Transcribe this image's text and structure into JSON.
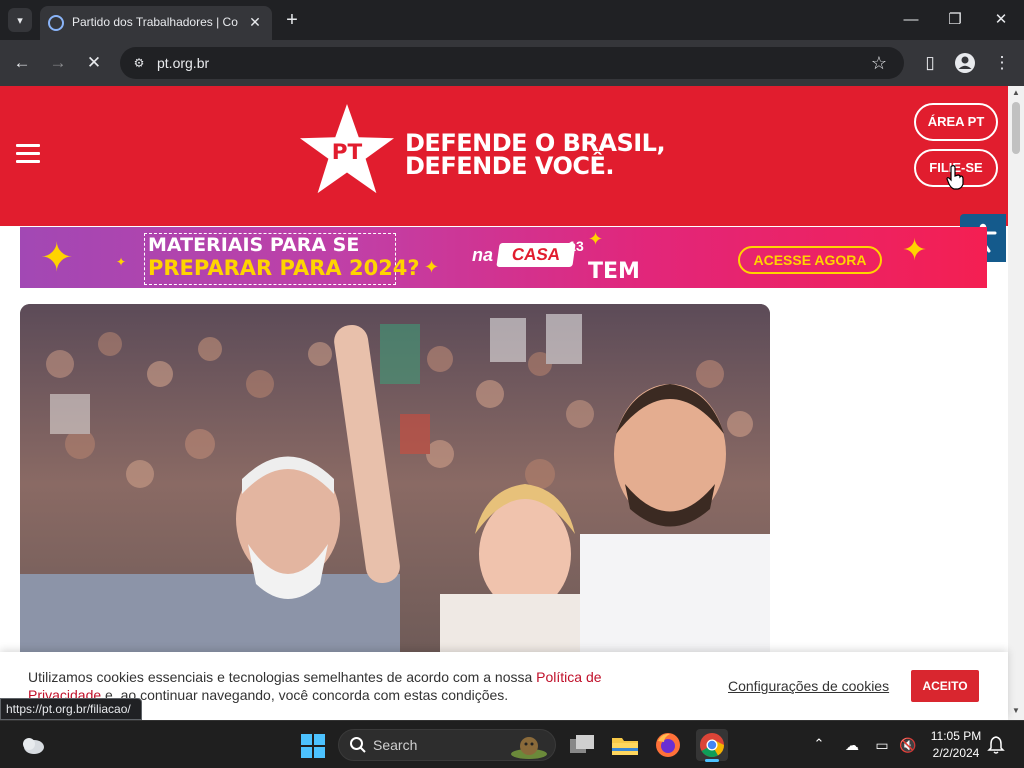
{
  "browser": {
    "tab_title": "Partido dos Trabalhadores | Co",
    "tab_close": "✕",
    "new_tab": "+",
    "url": "pt.org.br",
    "status_url": "https://pt.org.br/filiacao/",
    "window_buttons": {
      "minimize": "—",
      "restore": "❐",
      "close": "✕"
    }
  },
  "header": {
    "logo_text": "PT",
    "slogan_line1": "DEFENDE O BRASIL,",
    "slogan_line2": "DEFENDE VOCÊ.",
    "area_pt": "ÁREA PT",
    "filie_se": "FILIE-SE"
  },
  "banner": {
    "line1": "MATERIAIS PARA SE",
    "line2": "PREPARAR PARA 2024?",
    "na": "na",
    "casa": "CASA",
    "number": "13",
    "tem": "TEM",
    "cta": "ACESSE AGORA"
  },
  "cookie": {
    "text_before": "Utilizamos cookies essenciais e tecnologias semelhantes de acordo com a nossa ",
    "link": "Política de Privacidade",
    "text_after": " e, ao continuar navegando, você concorda com estas condições.",
    "settings": "Configurações de cookies",
    "accept": "ACEITO"
  },
  "taskbar": {
    "search_placeholder": "Search",
    "time": "11:05 PM",
    "date": "2/2/2024"
  },
  "colors": {
    "brand_red": "#e11d2e",
    "accent_yellow": "#ffd400",
    "accessibility_blue": "#145a8c"
  }
}
